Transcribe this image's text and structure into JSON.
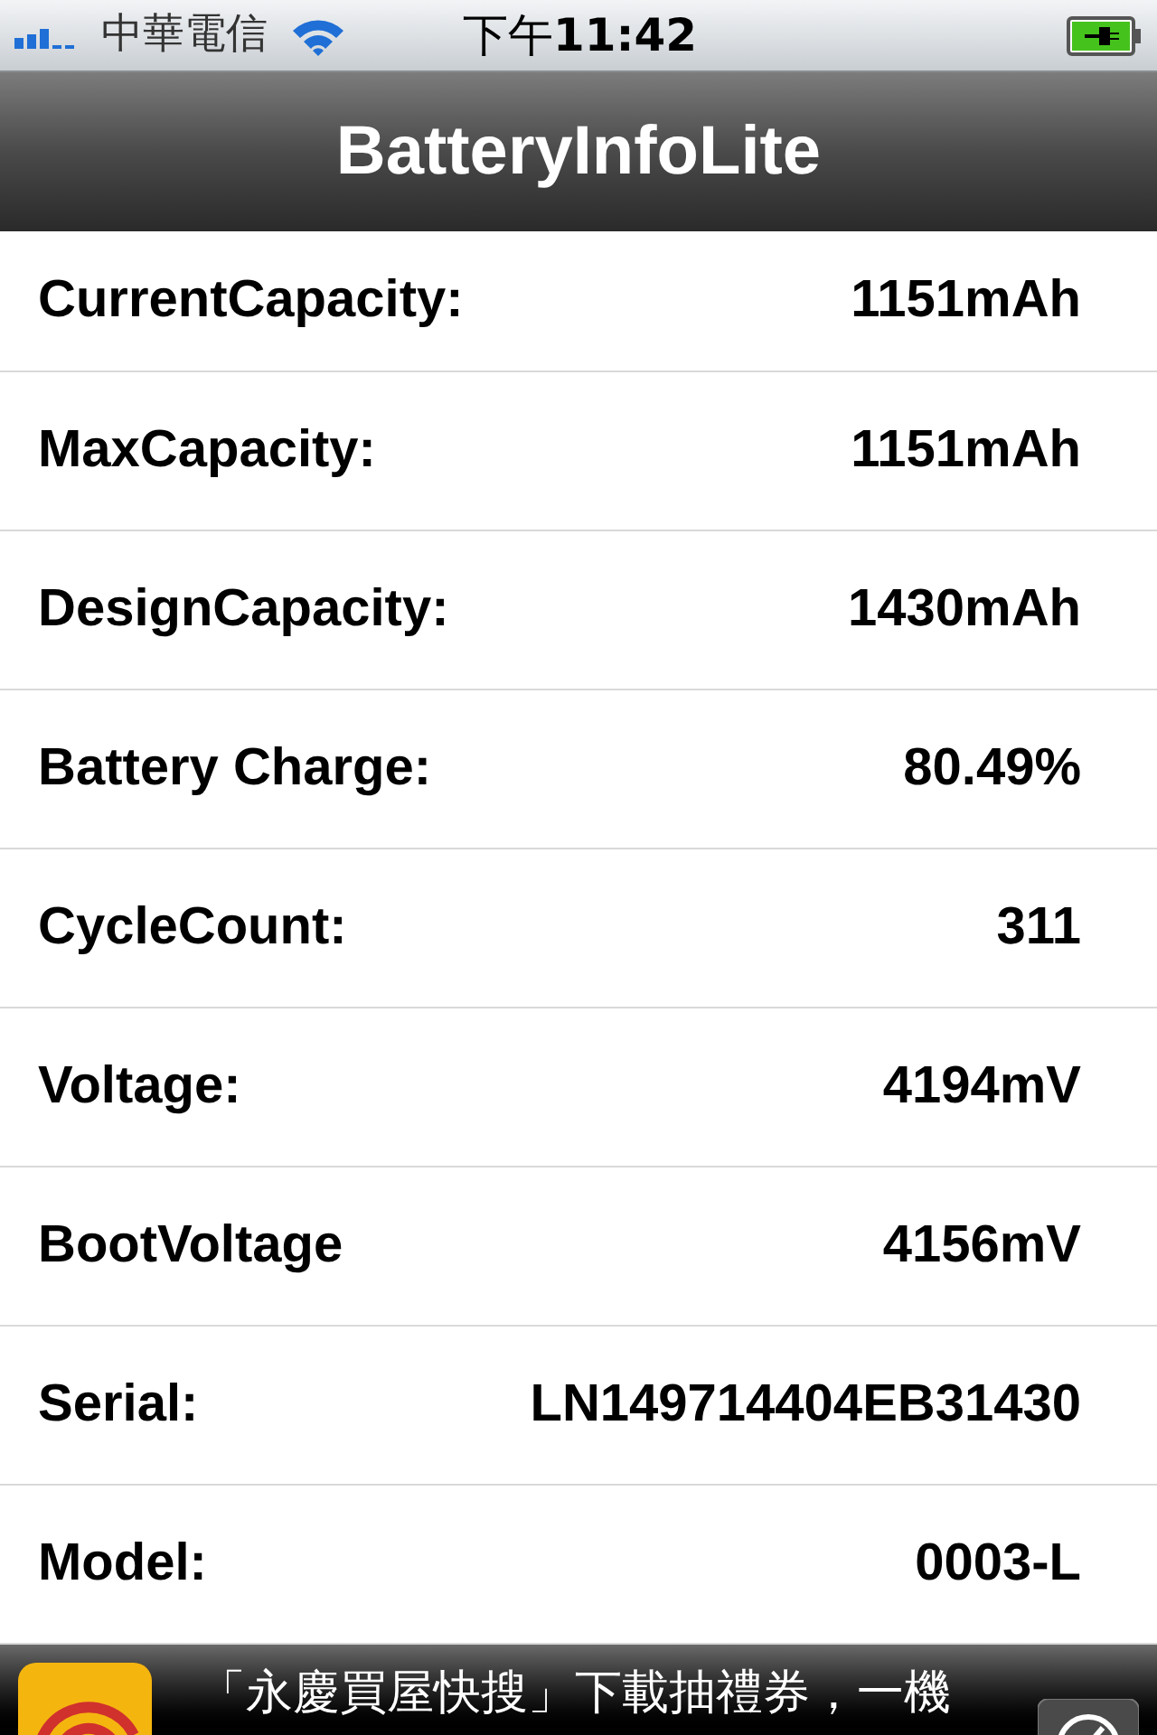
{
  "status_bar": {
    "carrier": "中華電信",
    "time": "下午**11:42**"
  },
  "nav_bar": {
    "title": "BatteryInfoLite"
  },
  "rows": [
    {
      "label": "CurrentCapacity:",
      "value": "1151mAh"
    },
    {
      "label": "MaxCapacity:",
      "value": "1151mAh"
    },
    {
      "label": "DesignCapacity:",
      "value": "1430mAh"
    },
    {
      "label": "Battery Charge:",
      "value": "80.49%"
    },
    {
      "label": "CycleCount:",
      "value": "311"
    },
    {
      "label": "Voltage:",
      "value": "4194mV"
    },
    {
      "label": "BootVoltage",
      "value": "4156mV"
    },
    {
      "label": "Serial:",
      "value": "LN149714404EB31430"
    },
    {
      "label": "Model:",
      "value": "0003-L"
    }
  ],
  "ad_banner": {
    "text": "「永慶買屋快搜」下載抽禮券，一機"
  }
}
